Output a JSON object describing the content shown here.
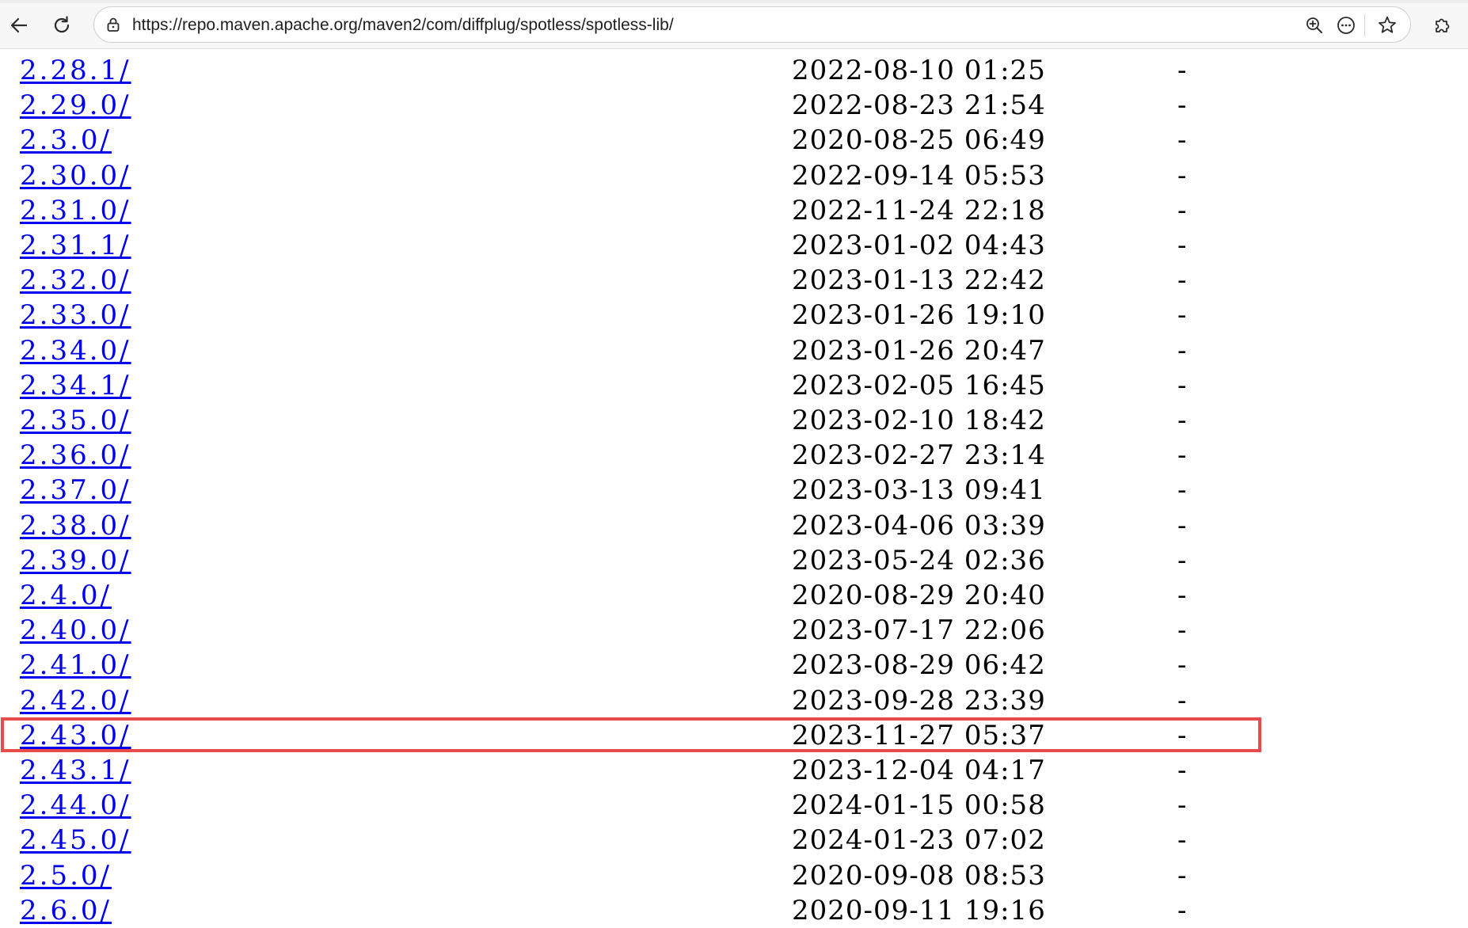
{
  "browser": {
    "url": "https://repo.maven.apache.org/maven2/com/diffplug/spotless/spotless-lib/",
    "icons": [
      "back-arrow-icon",
      "reload-icon",
      "lock-icon",
      "zoom-in-icon",
      "more-options-icon",
      "favorite-star-icon",
      "extensions-puzzle-icon"
    ]
  },
  "listing": {
    "rows": [
      {
        "name": "2.28.1/",
        "date": "2022-08-10 01:25",
        "size": "-"
      },
      {
        "name": "2.29.0/",
        "date": "2022-08-23 21:54",
        "size": "-"
      },
      {
        "name": "2.3.0/",
        "date": "2020-08-25 06:49",
        "size": "-"
      },
      {
        "name": "2.30.0/",
        "date": "2022-09-14 05:53",
        "size": "-"
      },
      {
        "name": "2.31.0/",
        "date": "2022-11-24 22:18",
        "size": "-"
      },
      {
        "name": "2.31.1/",
        "date": "2023-01-02 04:43",
        "size": "-"
      },
      {
        "name": "2.32.0/",
        "date": "2023-01-13 22:42",
        "size": "-"
      },
      {
        "name": "2.33.0/",
        "date": "2023-01-26 19:10",
        "size": "-"
      },
      {
        "name": "2.34.0/",
        "date": "2023-01-26 20:47",
        "size": "-"
      },
      {
        "name": "2.34.1/",
        "date": "2023-02-05 16:45",
        "size": "-"
      },
      {
        "name": "2.35.0/",
        "date": "2023-02-10 18:42",
        "size": "-"
      },
      {
        "name": "2.36.0/",
        "date": "2023-02-27 23:14",
        "size": "-"
      },
      {
        "name": "2.37.0/",
        "date": "2023-03-13 09:41",
        "size": "-"
      },
      {
        "name": "2.38.0/",
        "date": "2023-04-06 03:39",
        "size": "-"
      },
      {
        "name": "2.39.0/",
        "date": "2023-05-24 02:36",
        "size": "-"
      },
      {
        "name": "2.4.0/",
        "date": "2020-08-29 20:40",
        "size": "-"
      },
      {
        "name": "2.40.0/",
        "date": "2023-07-17 22:06",
        "size": "-"
      },
      {
        "name": "2.41.0/",
        "date": "2023-08-29 06:42",
        "size": "-"
      },
      {
        "name": "2.42.0/",
        "date": "2023-09-28 23:39",
        "size": "-"
      },
      {
        "name": "2.43.0/",
        "date": "2023-11-27 05:37",
        "size": "-",
        "highlighted": true
      },
      {
        "name": "2.43.1/",
        "date": "2023-12-04 04:17",
        "size": "-"
      },
      {
        "name": "2.44.0/",
        "date": "2024-01-15 00:58",
        "size": "-"
      },
      {
        "name": "2.45.0/",
        "date": "2024-01-23 07:02",
        "size": "-"
      },
      {
        "name": "2.5.0/",
        "date": "2020-09-08 08:53",
        "size": "-"
      },
      {
        "name": "2.6.0/",
        "date": "2020-09-11 19:16",
        "size": "-"
      }
    ]
  },
  "colors": {
    "link": "#0000ee",
    "highlight_border": "#e84b4b",
    "text": "#000000"
  }
}
